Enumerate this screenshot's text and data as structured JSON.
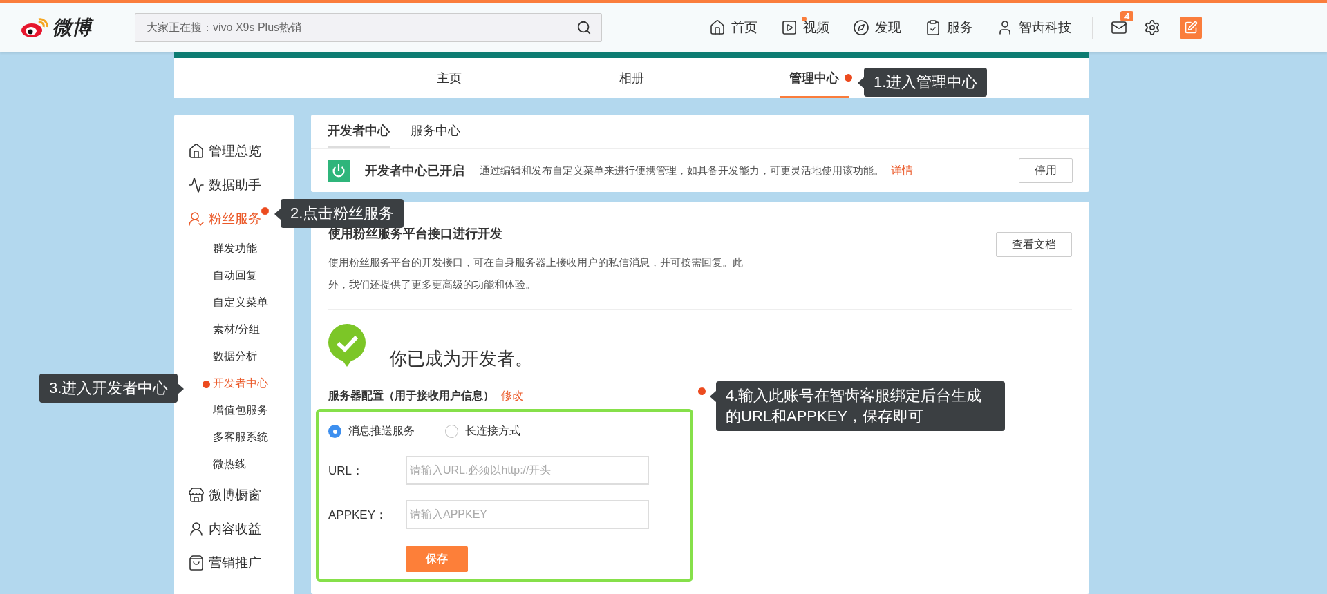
{
  "header": {
    "logo_text": "微博",
    "search": {
      "placeholder": "大家正在搜：vivo X9s Plus热销"
    },
    "nav": [
      {
        "label": "首页",
        "dot": false
      },
      {
        "label": "视频",
        "dot": true
      },
      {
        "label": "发现",
        "dot": false
      },
      {
        "label": "服务",
        "dot": false
      },
      {
        "label": "智齿科技",
        "dot": false
      }
    ],
    "mail_badge": "4"
  },
  "profile_tabs": [
    {
      "label": "主页",
      "selected": false
    },
    {
      "label": "相册",
      "selected": false
    },
    {
      "label": "管理中心",
      "selected": true
    }
  ],
  "sidebar": {
    "items": [
      {
        "label": "管理总览",
        "selected": false
      },
      {
        "label": "数据助手",
        "selected": false
      },
      {
        "label": "粉丝服务",
        "selected": true,
        "children": [
          {
            "label": "群发功能",
            "selected": false
          },
          {
            "label": "自动回复",
            "selected": false
          },
          {
            "label": "自定义菜单",
            "selected": false
          },
          {
            "label": "素材/分组",
            "selected": false
          },
          {
            "label": "数据分析",
            "selected": false
          },
          {
            "label": "开发者中心",
            "selected": true
          },
          {
            "label": "增值包服务",
            "selected": false
          },
          {
            "label": "多客服系统",
            "selected": false
          },
          {
            "label": "微热线",
            "selected": false
          }
        ]
      },
      {
        "label": "微博橱窗",
        "selected": false
      },
      {
        "label": "内容收益",
        "selected": false
      },
      {
        "label": "营销推广",
        "selected": false
      }
    ]
  },
  "main_tabs": [
    {
      "label": "开发者中心",
      "selected": true
    },
    {
      "label": "服务中心",
      "selected": false
    }
  ],
  "status": {
    "title": "开发者中心已开启",
    "text": "通过编辑和发布自定义菜单来进行便携管理，如具备开发能力，可更灵活地使用该功能。",
    "link": "详情",
    "button": "停用"
  },
  "api": {
    "title": "使用粉丝服务平台接口进行开发",
    "description": "使用粉丝服务平台的开发接口，可在自身服务器上接收用户的私信消息，并可按需回复。此外，我们还提供了更多更高级的功能和体验。",
    "button": "查看文档"
  },
  "success": "你已成为开发者。",
  "server_config": {
    "label": "服务器配置（用于接收用户信息）",
    "edit": "修改",
    "modes": [
      {
        "label": "消息推送服务",
        "selected": true
      },
      {
        "label": "长连接方式",
        "selected": false
      }
    ],
    "fields": [
      {
        "label": "URL：",
        "placeholder": "请输入URL,必须以http://开头"
      },
      {
        "label": "APPKEY：",
        "placeholder": "请输入APPKEY"
      }
    ],
    "save": "保存"
  },
  "annotations": [
    {
      "text": "1.进入管理中心"
    },
    {
      "text": "2.点击粉丝服务"
    },
    {
      "text": "3.进入开发者中心"
    },
    {
      "text": "4.输入此账号在智齿客服绑定后台生成的URL和APPKEY，保存即可"
    }
  ]
}
